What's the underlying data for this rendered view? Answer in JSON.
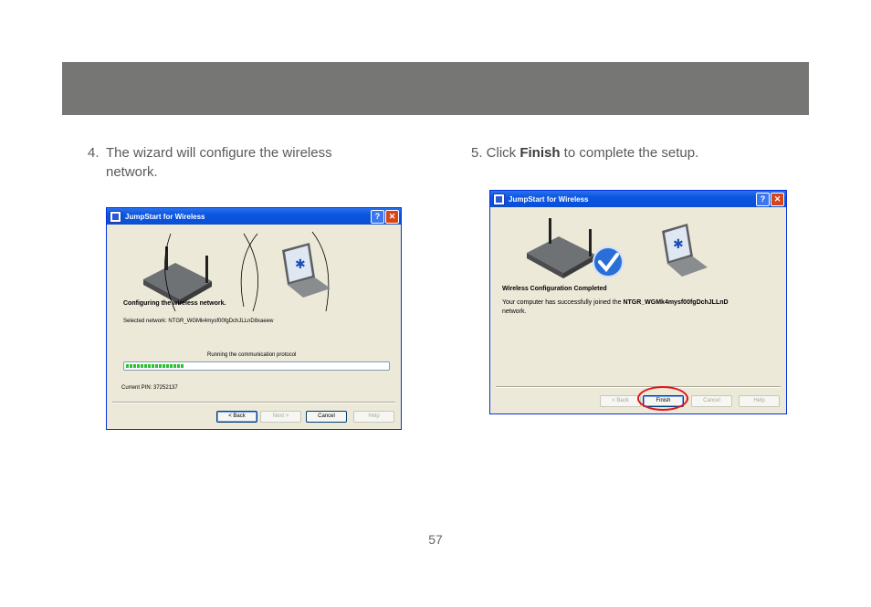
{
  "steps": {
    "step4": {
      "number": "4.",
      "line1": "The wizard will configure the wireless",
      "line2": "network."
    },
    "step5": {
      "prefix": "5. Click ",
      "bold": "Finish",
      "suffix": " to complete the setup."
    }
  },
  "dialog1": {
    "title": "JumpStart for Wireless",
    "heading": "Configuring the wireless network.",
    "selected_network": "Selected network: NTGR_WGMk4mysf00fgDchJLLnD8xaeew",
    "status": "Running the communication protocol",
    "progress_percent": 22,
    "pin": "Current PIN: 37252137",
    "buttons": {
      "back": "< Back",
      "next": "Next >",
      "cancel": "Cancel",
      "help": "Help"
    }
  },
  "dialog2": {
    "title": "JumpStart for Wireless",
    "heading": "Wireless Configuration Completed",
    "message_line1_prefix": "Your computer has successfully joined the ",
    "message_network": "NTGR_WGMk4mysf00fgDchJLLnD",
    "message_line2": "network.",
    "buttons": {
      "back": "< Back",
      "finish": "Finish",
      "cancel": "Cancel",
      "help": "Help"
    }
  },
  "icons": {
    "help": "question-mark-icon",
    "close": "close-x-icon",
    "success": "checkmark-icon"
  },
  "colors": {
    "header_band": "#767775",
    "highlight_ring": "#e2141c",
    "progress": "#2fbf32"
  },
  "page_number": "57"
}
